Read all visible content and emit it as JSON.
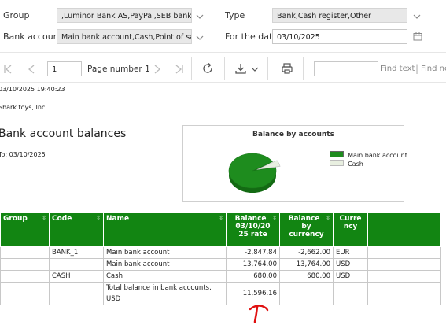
{
  "filters": {
    "group_label": "Group",
    "group_value": ",Luminor Bank AS,PayPal,SEB bank,Sw",
    "type_label": "Type",
    "type_value": "Bank,Cash register,Other",
    "bank_account_label": "Bank account",
    "bank_account_value": "Main bank account,Cash,Point of sale",
    "for_the_date_label": "For the date",
    "for_the_date_value": "03/10/2025"
  },
  "toolbar": {
    "page_input": "1",
    "page_label": "Page number 1",
    "find_text": "Find text",
    "find_next": "Find ne"
  },
  "report": {
    "timestamp": "03/10/2025  19:40:23",
    "company": "Shark toys, Inc.",
    "title": "Bank account balances",
    "to_date": "To: 03/10/2025"
  },
  "chart": {
    "title": "Balance by accounts",
    "legend": [
      {
        "name": "Main bank account",
        "color": "#1e8c1e"
      },
      {
        "name": "Cash",
        "color": "#e8efe0"
      }
    ]
  },
  "chart_data": {
    "type": "pie",
    "title": "Balance by accounts",
    "categories": [
      "Main bank account",
      "Cash"
    ],
    "values": [
      10916.16,
      680.0
    ],
    "legend_position": "right"
  },
  "table": {
    "headers": {
      "group": "Group",
      "code": "Code",
      "name": "Name",
      "balance_line1": "Balance",
      "balance_line2": "03/10/20",
      "balance_line3": "25 rate",
      "bycur_line1": "Balance",
      "bycur_line2": "by",
      "bycur_line3": "currency",
      "cur_line1": "Curre",
      "cur_line2": "ncy"
    },
    "rows": [
      {
        "group": "",
        "code": "BANK_1",
        "name": "Main bank account",
        "balance": "-2,847.84",
        "by_currency": "-2,662.00",
        "currency": "EUR"
      },
      {
        "group": "",
        "code": "",
        "name": "Main bank account",
        "balance": "13,764.00",
        "by_currency": "13,764.00",
        "currency": "USD"
      },
      {
        "group": "",
        "code": "CASH",
        "name": "Cash",
        "balance": "680.00",
        "by_currency": "680.00",
        "currency": "USD"
      },
      {
        "group": "",
        "code": "",
        "name": "Total balance in bank accounts, USD",
        "balance": "11,596.16",
        "by_currency": "",
        "currency": ""
      }
    ]
  },
  "colors": {
    "header_green": "#128512",
    "annotation_red": "#e01010"
  }
}
